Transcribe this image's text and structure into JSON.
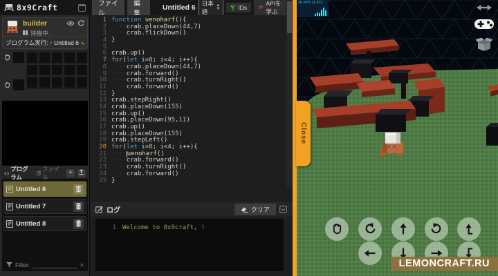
{
  "colors": {
    "accent": "#F0A427",
    "selection_olive": "#6E6837",
    "log_green": "#8CA65A",
    "sky": "#05090F",
    "grass": "#4E7B44",
    "slab_red": "#A63E28",
    "block_black": "#131317"
  },
  "logo": {
    "title": "8x9Craft"
  },
  "menubar": {
    "file": "ファイル",
    "edit": "編集",
    "title": "Untitled 6",
    "language": "日本語",
    "ids_label": "IDs",
    "api_label": "APIを学ぶ"
  },
  "robot": {
    "name": "builder",
    "status": "待機中...",
    "run_label": "プログラム実行:",
    "run_file": "Untitled 6"
  },
  "inventory": {
    "side_slots": 2,
    "grid_rows": 3,
    "grid_cols": 5
  },
  "programs": {
    "tab_program": "プログラム",
    "tab_file": "ファイル",
    "add_label": "+",
    "filter_label": "Filter:",
    "filter_clear": "×",
    "items": [
      {
        "name": "Untitled 6",
        "selected": true
      },
      {
        "name": "Untitled 7",
        "selected": false
      },
      {
        "name": "Untitled 8",
        "selected": false
      }
    ]
  },
  "editor": {
    "highlight_lines": [
      1,
      7,
      20
    ],
    "lines": [
      {
        "n": 1,
        "t": [
          [
            "kw",
            "function "
          ],
          [
            "fn",
            "uenoharf"
          ],
          [
            "pl",
            "(){"
          ]
        ]
      },
      {
        "n": 2,
        "t": [
          [
            "ws",
            "····"
          ],
          [
            "pl",
            "crab.placeDown("
          ],
          [
            "num",
            "44"
          ],
          [
            "pl",
            ","
          ],
          [
            "num",
            "7"
          ],
          [
            "pl",
            ")"
          ]
        ]
      },
      {
        "n": 3,
        "t": [
          [
            "ws",
            "····"
          ],
          [
            "pl",
            "crab.flickDown()"
          ]
        ]
      },
      {
        "n": 4,
        "t": [
          [
            "pl",
            "}"
          ]
        ]
      },
      {
        "n": 5,
        "t": []
      },
      {
        "n": 6,
        "t": [
          [
            "pl",
            "crab.up()"
          ]
        ]
      },
      {
        "n": 7,
        "t": [
          [
            "kw2",
            "for"
          ],
          [
            "pl",
            "("
          ],
          [
            "kw",
            "let"
          ],
          [
            "pl",
            " "
          ],
          [
            "var",
            "i"
          ],
          [
            "pl",
            "="
          ],
          [
            "num",
            "0"
          ],
          [
            "pl",
            "; "
          ],
          [
            "var",
            "i"
          ],
          [
            "pl",
            "<"
          ],
          [
            "num",
            "4"
          ],
          [
            "pl",
            "; "
          ],
          [
            "var",
            "i"
          ],
          [
            "pl",
            "++){"
          ]
        ]
      },
      {
        "n": 8,
        "t": [
          [
            "ws",
            "····"
          ],
          [
            "pl",
            "crab.placeDown("
          ],
          [
            "num",
            "44"
          ],
          [
            "pl",
            ","
          ],
          [
            "num",
            "7"
          ],
          [
            "pl",
            ")"
          ]
        ]
      },
      {
        "n": 9,
        "t": [
          [
            "ws",
            "····"
          ],
          [
            "pl",
            "crab.forward()"
          ]
        ]
      },
      {
        "n": 10,
        "t": [
          [
            "ws",
            "····"
          ],
          [
            "pl",
            "crab.turnRight()"
          ]
        ]
      },
      {
        "n": 11,
        "t": [
          [
            "ws",
            "····"
          ],
          [
            "pl",
            "crab.forward()"
          ]
        ]
      },
      {
        "n": 12,
        "t": [
          [
            "pl",
            "}"
          ]
        ]
      },
      {
        "n": 13,
        "t": [
          [
            "pl",
            "crab.stepRight()"
          ]
        ]
      },
      {
        "n": 14,
        "t": [
          [
            "pl",
            "crab.placeDown("
          ],
          [
            "num",
            "155"
          ],
          [
            "pl",
            ")"
          ]
        ]
      },
      {
        "n": 15,
        "t": [
          [
            "pl",
            "crab.up()"
          ]
        ]
      },
      {
        "n": 16,
        "t": [
          [
            "pl",
            "crab.placeDown("
          ],
          [
            "num",
            "95"
          ],
          [
            "pl",
            ","
          ],
          [
            "num",
            "11"
          ],
          [
            "pl",
            ")"
          ]
        ]
      },
      {
        "n": 17,
        "t": [
          [
            "pl",
            "crab.up()"
          ]
        ]
      },
      {
        "n": 18,
        "t": [
          [
            "pl",
            "crab.placeDown("
          ],
          [
            "num",
            "155"
          ],
          [
            "pl",
            ")"
          ]
        ]
      },
      {
        "n": 19,
        "t": [
          [
            "pl",
            "crab.stepLeft()"
          ]
        ]
      },
      {
        "n": 20,
        "t": [
          [
            "kw2",
            "for"
          ],
          [
            "pl",
            "("
          ],
          [
            "kw",
            "let"
          ],
          [
            "pl",
            " "
          ],
          [
            "var",
            "i"
          ],
          [
            "pl",
            "="
          ],
          [
            "num",
            "0"
          ],
          [
            "pl",
            "; "
          ],
          [
            "var",
            "i"
          ],
          [
            "pl",
            "<"
          ],
          [
            "num",
            "4"
          ],
          [
            "pl",
            "; "
          ],
          [
            "var",
            "i"
          ],
          [
            "pl",
            "++){"
          ]
        ]
      },
      {
        "n": 21,
        "t": [
          [
            "ws",
            "····"
          ],
          [
            "caret",
            ""
          ],
          [
            "fn",
            "uenoharf"
          ],
          [
            "pl",
            "()"
          ]
        ]
      },
      {
        "n": 22,
        "t": [
          [
            "ws",
            "····"
          ],
          [
            "pl",
            "crab.forward()"
          ]
        ]
      },
      {
        "n": 23,
        "t": [
          [
            "ws",
            "····"
          ],
          [
            "pl",
            "crab.turnRight()"
          ]
        ]
      },
      {
        "n": 24,
        "t": [
          [
            "ws",
            "····"
          ],
          [
            "pl",
            "crab.forward()"
          ]
        ]
      },
      {
        "n": 25,
        "t": [
          [
            "pl",
            "}"
          ]
        ]
      }
    ]
  },
  "log": {
    "title": "ログ",
    "clear_label": "クリア",
    "entries": [
      {
        "n": "1",
        "text": "Welcome to 8x9craft, !"
      }
    ]
  },
  "game": {
    "fps": "20 FPS (1-57)",
    "close_label": "Close",
    "watermark": "LEMONCRAFT.RU",
    "controls": [
      {
        "name": "hand",
        "row": 1
      },
      {
        "name": "rotate-left",
        "row": 1
      },
      {
        "name": "move-forward",
        "row": 1
      },
      {
        "name": "rotate-right",
        "row": 1
      },
      {
        "name": "step-up",
        "row": 1
      },
      {
        "name": "move-left",
        "row": 2
      },
      {
        "name": "move-back",
        "row": 2
      },
      {
        "name": "move-right",
        "row": 2
      },
      {
        "name": "step-down",
        "row": 2
      }
    ]
  }
}
